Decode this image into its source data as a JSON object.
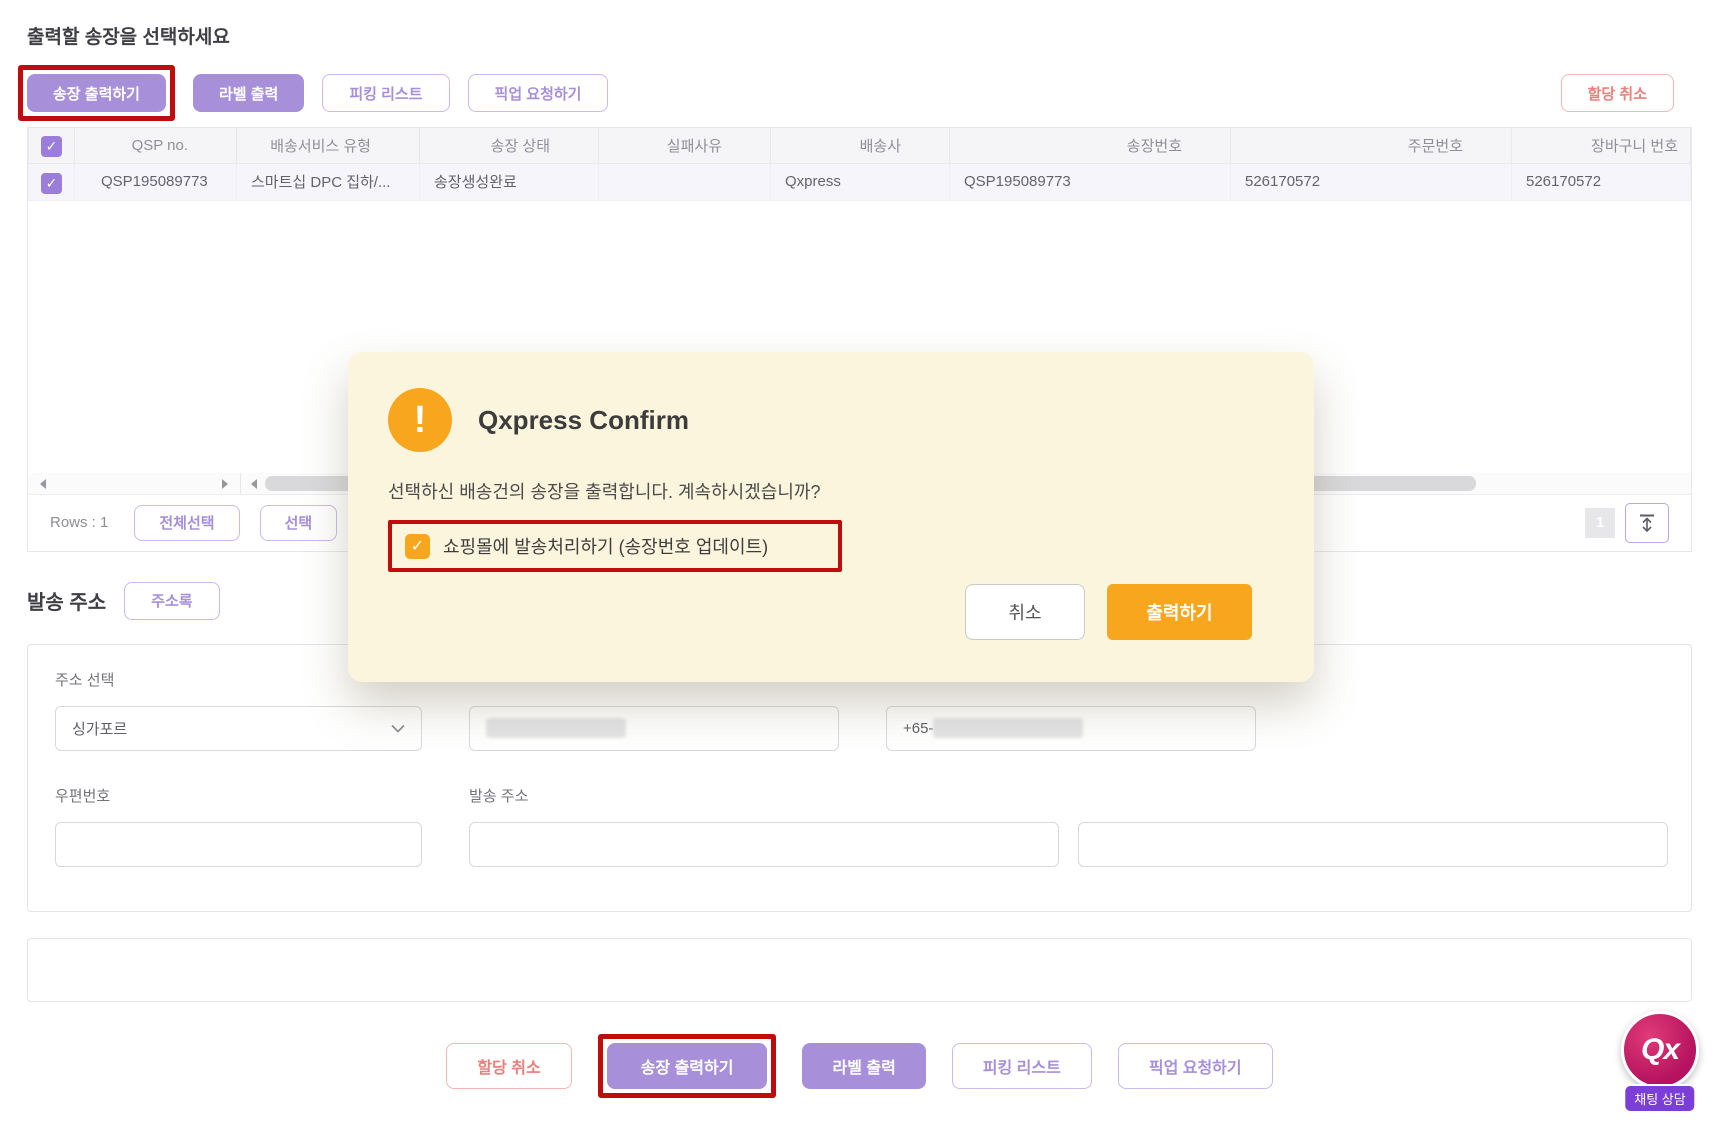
{
  "page": {
    "title": "출력할 송장을 선택하세요"
  },
  "toolbar_top": {
    "print_invoice": "송장 출력하기",
    "print_label": "라벨 출력",
    "picking_list": "피킹 리스트",
    "pickup_request": "픽업 요청하기",
    "cancel_assignment": "할당 취소"
  },
  "table": {
    "columns": [
      "",
      "QSP no.",
      "배송서비스 유형",
      "송장 상태",
      "실패사유",
      "배송사",
      "송장번호",
      "주문번호",
      "장바구니 번호"
    ],
    "rows": [
      {
        "qsp_no": "QSP195089773",
        "service_type": "스마트십 DPC 집하/...",
        "invoice_status": "송장생성완료",
        "fail_reason": "",
        "carrier": "Qxpress",
        "invoice_no": "QSP195089773",
        "order_no": "526170572",
        "cart_no": "526170572"
      }
    ],
    "rows_count_label": "Rows : 1",
    "select_all": "전체선택",
    "select": "선택",
    "page_number": "1"
  },
  "modal": {
    "title": "Qxpress Confirm",
    "message": "선택하신 배송건의 송장을 출력합니다. 계속하시겠습니까?",
    "warning_glyph": "!",
    "checkbox_label": "쇼핑몰에 발송처리하기 (송장번호 업데이트)",
    "checkbox_checked": true,
    "cancel": "취소",
    "confirm": "출력하기"
  },
  "address": {
    "section_title": "발송 주소",
    "address_book": "주소록",
    "select_label": "주소 선택",
    "country_value": "싱가포르",
    "phone_prefix": "+65-",
    "postal_label": "우편번호",
    "address_label": "발송 주소"
  },
  "toolbar_bottom": {
    "cancel_assignment": "할당 취소",
    "print_invoice": "송장 출력하기",
    "print_label": "라벨 출력",
    "picking_list": "피킹 리스트",
    "pickup_request": "픽업 요청하기"
  },
  "chat": {
    "logo": "Qx",
    "label": "채팅 상담"
  },
  "colors": {
    "accent_purple": "#a78fd9",
    "highlight_red": "#bf0d0d",
    "warning_orange": "#f7a61d",
    "modal_cream": "#fcf5dd",
    "brand_magenta": "#b5125f",
    "danger_text": "#e8807c"
  }
}
